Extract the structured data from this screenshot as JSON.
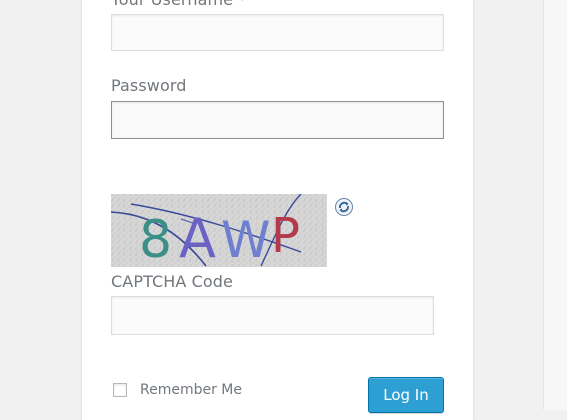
{
  "form": {
    "username_label": "Your Username",
    "username_required": "*",
    "username_value": "",
    "password_label": "Password",
    "password_value": "",
    "captcha_image_text": "8AWP",
    "captcha_label": "CAPTCHA Code",
    "captcha_value": "",
    "remember_label": "Remember Me",
    "remember_checked": false,
    "submit_label": "Log In"
  },
  "icons": {
    "refresh": "refresh-icon",
    "checkbox": "checkbox-icon"
  },
  "colors": {
    "page_bg": "#f1f1f1",
    "button_bg": "#2e9fd2",
    "button_border": "#0073aa",
    "label_text": "#72777c"
  }
}
